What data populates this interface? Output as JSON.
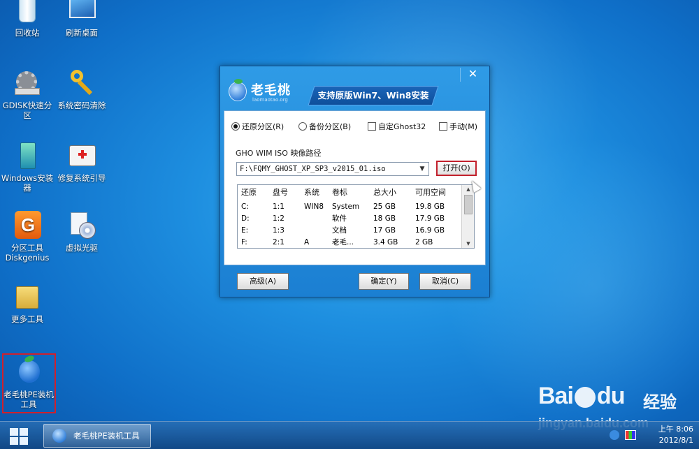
{
  "desktop": {
    "icons": [
      {
        "id": "recycle-bin",
        "label": "回收站"
      },
      {
        "id": "refresh-desktop",
        "label": "刷新桌面"
      },
      {
        "id": "gdisk",
        "label": "GDISK快速分区"
      },
      {
        "id": "password-clear",
        "label": "系统密码清除"
      },
      {
        "id": "windows-installer",
        "label": "Windows安装器"
      },
      {
        "id": "repair-boot",
        "label": "修复系统引导"
      },
      {
        "id": "diskgenius",
        "label": "分区工具Diskgenius"
      },
      {
        "id": "virtual-cd",
        "label": "虚拟光驱"
      },
      {
        "id": "more-tools",
        "label": "更多工具"
      },
      {
        "id": "pe-installer",
        "label": "老毛桃PE装机工具"
      }
    ]
  },
  "dialog": {
    "close_label": "✕",
    "logo_name": "老毛桃",
    "logo_url": "laomaotao.org",
    "banner": "支持原版Win7、Win8安装",
    "options": {
      "restore": "还原分区(R)",
      "backup": "备份分区(B)",
      "custom_ghost": "自定Ghost32",
      "manual": "手动(M)",
      "selected": "restore"
    },
    "path_label": "GHO WIM ISO 映像路径",
    "path_value": "F:\\FQMY_GHOST_XP_SP3_v2015_01.iso",
    "open_button": "打开(O)",
    "table": {
      "headers": [
        "还原",
        "盘号",
        "系统",
        "卷标",
        "总大小",
        "可用空间"
      ],
      "rows": [
        [
          "C:",
          "1:1",
          "WIN8",
          "System",
          "25 GB",
          "19.8 GB"
        ],
        [
          "D:",
          "1:2",
          "",
          "软件",
          "18 GB",
          "17.9 GB"
        ],
        [
          "E:",
          "1:3",
          "",
          "文档",
          "17 GB",
          "16.9 GB"
        ],
        [
          "F:",
          "2:1",
          "A",
          "老毛...",
          "3.4 GB",
          "2 GB"
        ]
      ]
    },
    "advanced_button": "高级(A)",
    "ok_button": "确定(Y)",
    "cancel_button": "取消(C)"
  },
  "taskbar": {
    "task_label": "老毛桃PE装机工具",
    "time": "上午 8:06",
    "date": "2012/8/1"
  },
  "watermark": {
    "brand_left": "Bai",
    "brand_right": "du",
    "brand_cn": "经验",
    "site": "jingyan.baidu.com"
  }
}
